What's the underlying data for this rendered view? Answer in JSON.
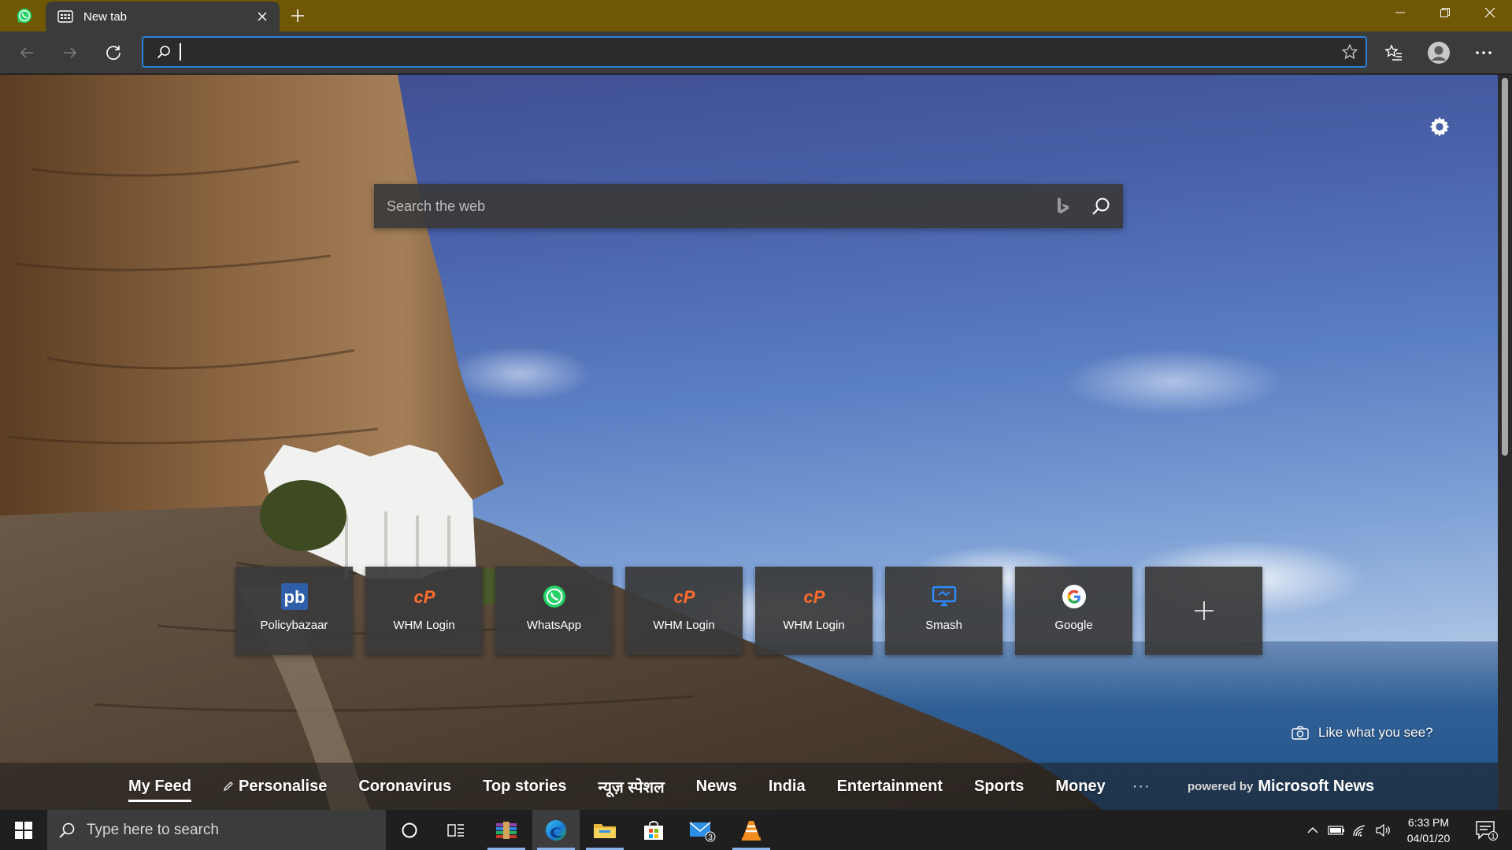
{
  "browser": {
    "tab": {
      "title": "New tab"
    },
    "address_bar": {
      "value": "",
      "placeholder": ""
    }
  },
  "new_tab_page": {
    "web_search": {
      "placeholder": "Search the web"
    },
    "quick_links": [
      {
        "label": "Policybazaar",
        "icon": "policybazaar-icon"
      },
      {
        "label": "WHM Login",
        "icon": "cpanel-icon"
      },
      {
        "label": "WhatsApp",
        "icon": "whatsapp-icon"
      },
      {
        "label": "WHM Login",
        "icon": "cpanel-icon"
      },
      {
        "label": "WHM Login",
        "icon": "cpanel-icon"
      },
      {
        "label": "Smash",
        "icon": "monitor-icon"
      },
      {
        "label": "Google",
        "icon": "google-icon"
      }
    ],
    "like_what_you_see": "Like what you see?",
    "feed_nav": {
      "items": [
        "My Feed",
        "Personalise",
        "Coronavirus",
        "Top stories",
        "न्यूज़ स्पेशल",
        "News",
        "India",
        "Entertainment",
        "Sports",
        "Money"
      ],
      "more": "···",
      "powered_by_prefix": "powered by",
      "powered_by_brand": "Microsoft News"
    }
  },
  "taskbar": {
    "search_placeholder": "Type here to search",
    "mail_badge": "3",
    "time": "6:33 PM",
    "date": "04/01/20",
    "notification_count": "1"
  },
  "colors": {
    "titlebar": "#6f5704",
    "toolbar": "#3b3b3b",
    "address_focus": "#2a82d8",
    "cpanel_orange": "#ff6c2c",
    "whatsapp_green": "#25d366"
  }
}
